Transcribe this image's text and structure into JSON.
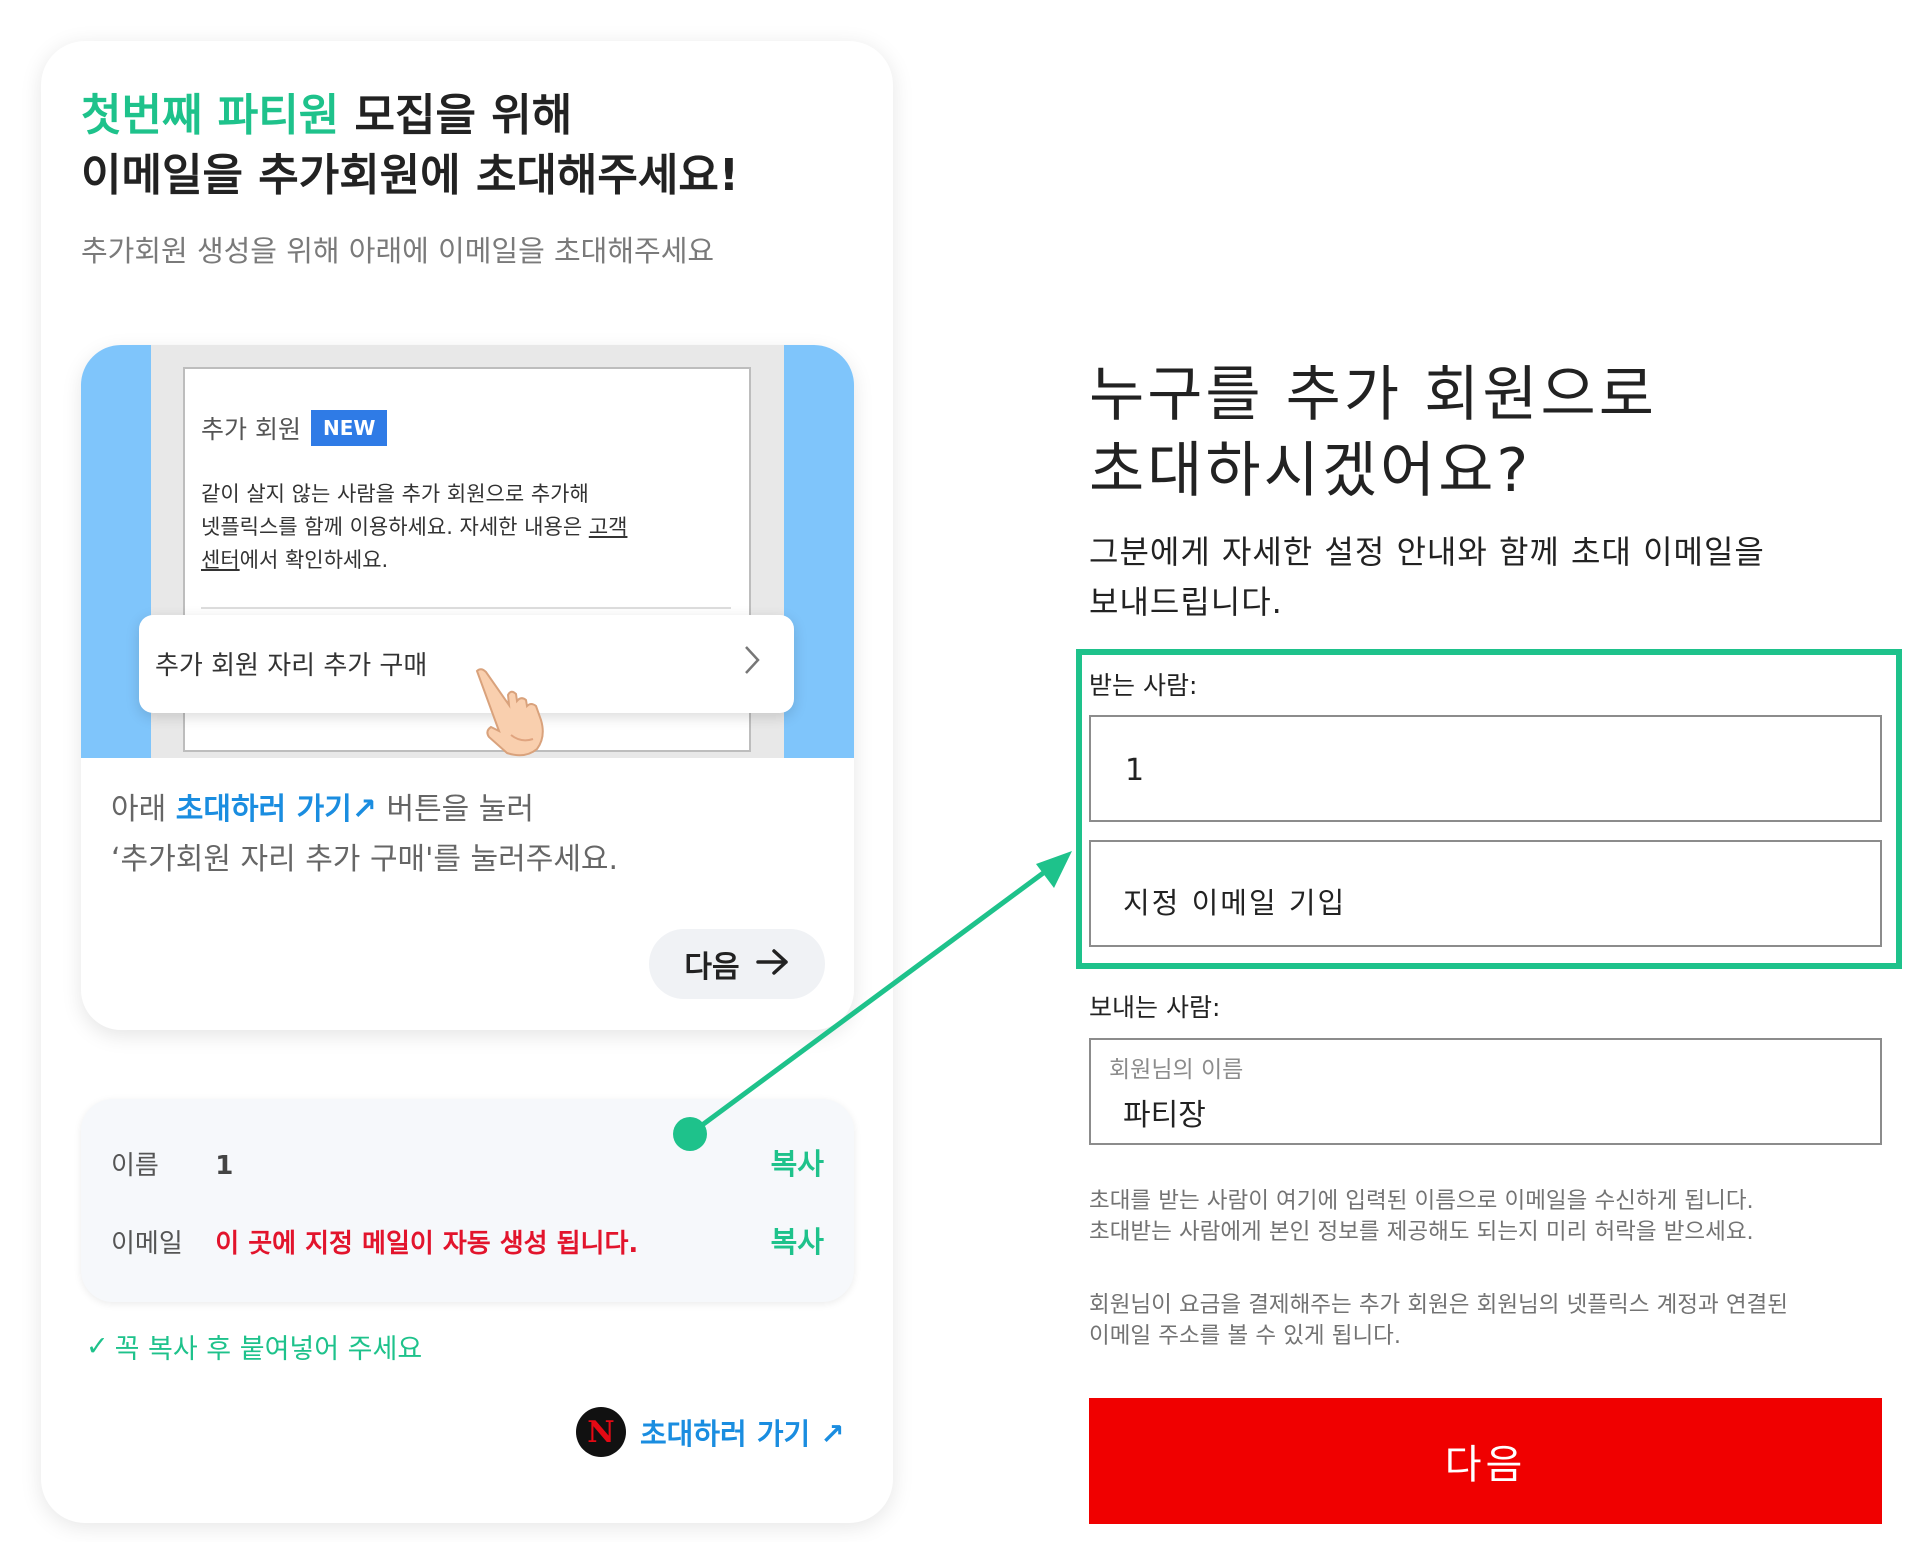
{
  "left": {
    "title_accent": "첫번째 파티원",
    "title_rest": " 모집을 위해",
    "title_line2": "이메일을 추가회원에 초대해주세요!",
    "subtitle": "추가회원 생성을 위해 아래에 이메일을 초대해주세요",
    "guide": {
      "mock_header_label": "추가 회원",
      "mock_badge": "NEW",
      "mock_desc_1": "같이 살지 않는 사람을 추가 회원으로 추가해",
      "mock_desc_2a": "넷플릭스를 함께 이용하세요. 자세한 내용은 ",
      "mock_desc_2b": "고객",
      "mock_desc_3a": "센터",
      "mock_desc_3b": "에서 확인하세요.",
      "mock_option": "추가 회원 자리 추가 구매",
      "text_line1_pre": "아래 ",
      "text_line1_link": "초대하러 가기↗",
      "text_line1_post": " 버튼을 눌러",
      "text_line2": "‘추가회원 자리 추가 구매'를 눌러주세요.",
      "next_label": "다음"
    },
    "info": {
      "name_label": "이름",
      "name_value": "1",
      "email_label": "이메일",
      "email_value": "이 곳에 지정 메일이 자동 생성 됩니다.",
      "copy_label": "복사"
    },
    "hint": "꼭 복사 후 붙여넣어 주세요",
    "hint_check": "✓",
    "netflix_letter": "N",
    "go_invite": "초대하러 가기 ↗"
  },
  "right": {
    "title_line1": "누구를 추가 회원으로",
    "title_line2": "초대하시겠어요?",
    "subtitle_line1": "그분에게 자세한 설정 안내와 함께 초대 이메일을",
    "subtitle_line2": "보내드립니다.",
    "to_label": "받는 사람:",
    "to_name_value": "1",
    "to_email_value": "지정 이메일 기입",
    "from_label": "보내는 사람:",
    "from_field_label": "회원님의 이름",
    "from_field_value": "파티장",
    "note1_line1": "초대를 받는 사람이 여기에 입력된 이름으로 이메일을 수신하게 됩니다.",
    "note1_line2": "초대받는 사람에게 본인 정보를 제공해도 되는지 미리 허락을 받으세요.",
    "note2_line1": "회원님이 요금을 결제해주는 추가 회원은 회원님의 넷플릭스 계정과 연결된",
    "note2_line2": "이메일 주소를 볼 수 있게 됩니다.",
    "next_button": "다음"
  },
  "colors": {
    "accent_green": "#1ec28b",
    "link_blue": "#1a8de0",
    "alert_red": "#e2142c",
    "netflix_red": "#f00000"
  },
  "icons": [
    "chevron-right-icon",
    "pointing-hand-icon",
    "arrow-right-icon",
    "check-icon",
    "netflix-logo",
    "connector-arrow"
  ]
}
